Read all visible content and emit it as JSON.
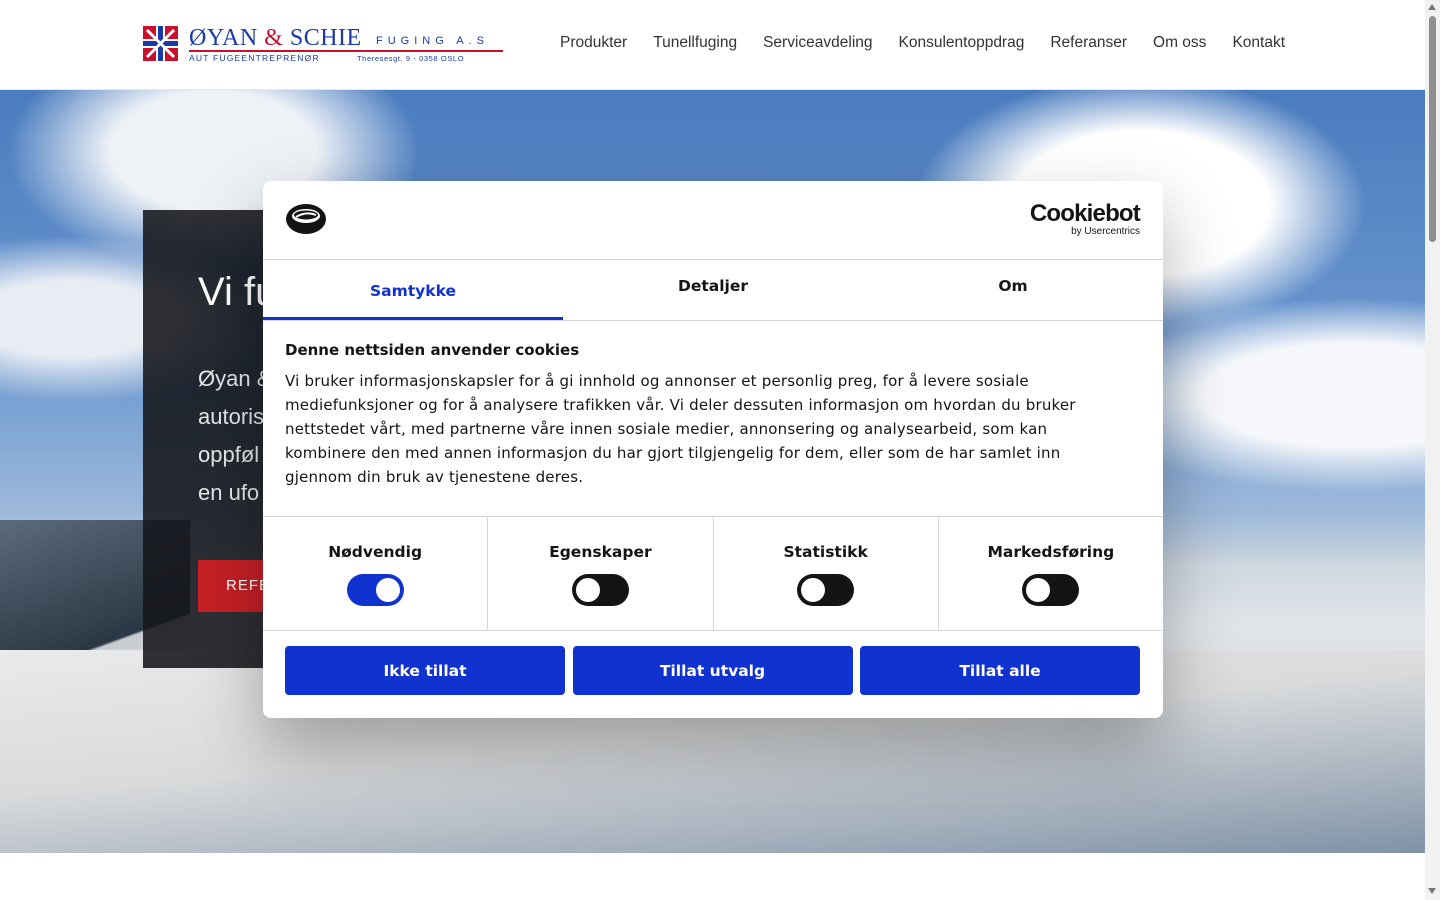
{
  "header": {
    "logo": {
      "name_part1": "ØYAN",
      "amp": "&",
      "name_part2": "SCHIE",
      "fuging": "FUGING A.S",
      "subtitle": "AUT FUGEENTREPRENØR",
      "address": "Theresesgt. 9 - 0358 OSLO"
    },
    "nav": [
      "Produkter",
      "Tunellfuging",
      "Serviceavdeling",
      "Konsulentoppdrag",
      "Referanser",
      "Om oss",
      "Kontakt"
    ]
  },
  "hero": {
    "title": "Vi fu",
    "text_lines": [
      "Øyan &",
      "autoris",
      "oppføl",
      "en ufo"
    ],
    "button_label": "REFE"
  },
  "cookie_dialog": {
    "brand": "Cookiebot",
    "brand_by": "by Usercentrics",
    "tabs": [
      "Samtykke",
      "Detaljer",
      "Om"
    ],
    "active_tab": "Samtykke",
    "heading": "Denne nettsiden anvender cookies",
    "text": "Vi bruker informasjonskapsler for å gi innhold og annonser et personlig preg, for å levere sosiale mediefunksjoner og for å analysere trafikken vår. Vi deler dessuten informasjon om hvordan du bruker nettstedet vårt, med partnerne våre innen sosiale medier, annonsering og analysearbeid, som kan kombinere den med annen informasjon du har gjort tilgjengelig for dem, eller som de har samlet inn gjennom din bruk av tjenestene deres.",
    "toggles": [
      {
        "label": "Nødvendig",
        "on": true
      },
      {
        "label": "Egenskaper",
        "on": false
      },
      {
        "label": "Statistikk",
        "on": false
      },
      {
        "label": "Markedsføring",
        "on": false
      }
    ],
    "buttons": [
      "Ikke tillat",
      "Tillat utvalg",
      "Tillat alle"
    ],
    "accent_color": "#1032cf"
  }
}
